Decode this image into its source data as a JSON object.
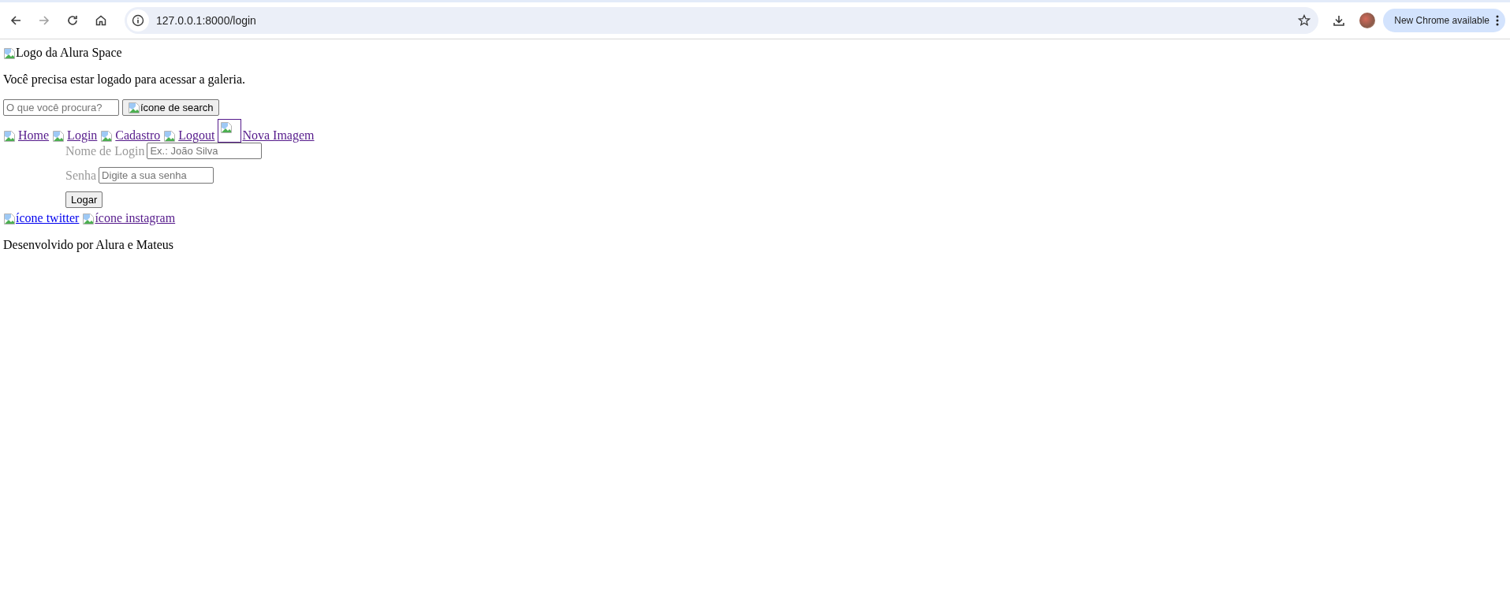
{
  "browser": {
    "back_enabled": true,
    "forward_enabled": false,
    "url": "127.0.0.1:8000/login",
    "update_button": "New Chrome available"
  },
  "page": {
    "logo_alt": "Logo da Alura Space",
    "message": "Você precisa estar logado para acessar a galeria.",
    "search": {
      "placeholder": "O que você procura?",
      "button": "ícone de search"
    },
    "nav": [
      {
        "label": "Home",
        "visited": true,
        "kind": "icon"
      },
      {
        "label": "Login",
        "visited": true,
        "kind": "icon"
      },
      {
        "label": "Cadastro",
        "visited": true,
        "kind": "icon"
      },
      {
        "label": "Logout",
        "visited": true,
        "kind": "icon"
      },
      {
        "label": "Nova Imagem",
        "visited": true,
        "kind": "framed"
      }
    ],
    "form": {
      "fields": [
        {
          "label": "Nome de Login",
          "placeholder": "Ex.: João Silva"
        },
        {
          "label": "Senha",
          "placeholder": "Digite a sua senha"
        }
      ],
      "submit": "Logar"
    },
    "social": [
      {
        "label": "ícone twitter",
        "visited": false
      },
      {
        "label": "ícone instagram",
        "visited": true
      }
    ],
    "footer": "Desenvolvido por Alura e Mateus"
  }
}
